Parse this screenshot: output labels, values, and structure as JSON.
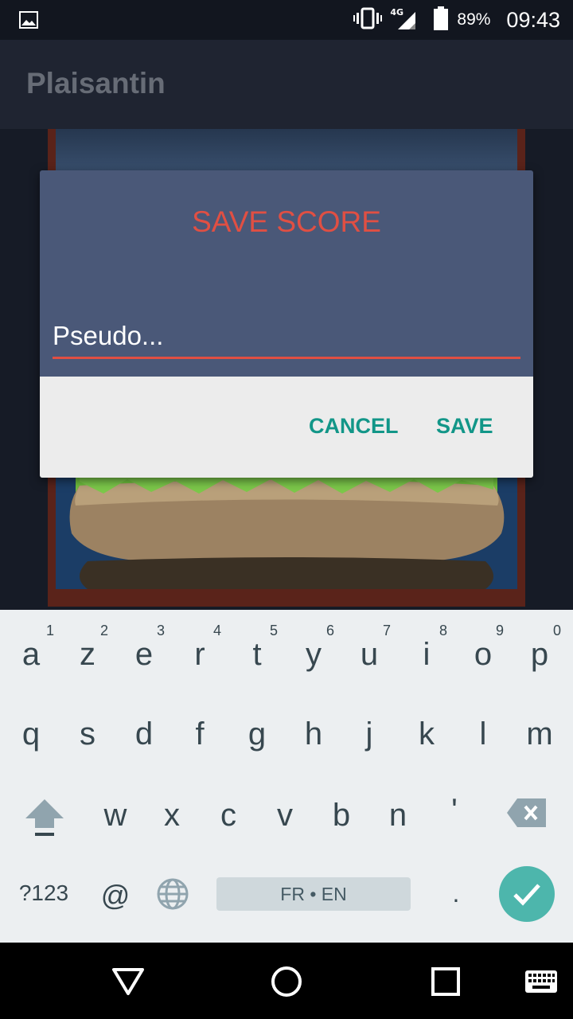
{
  "status_bar": {
    "network": "4G",
    "battery": "89%",
    "time": "09:43",
    "icons": [
      "image-icon",
      "vibrate-icon",
      "signal-icon",
      "battery-icon"
    ]
  },
  "app_bar": {
    "title": "Plaisantin"
  },
  "dialog": {
    "title": "SAVE SCORE",
    "input_placeholder": "Pseudo...",
    "input_value": "",
    "cancel_label": "CANCEL",
    "save_label": "SAVE",
    "accent": "#e04f43",
    "button_color": "#129688"
  },
  "keyboard": {
    "row1": [
      {
        "k": "a",
        "h": "1"
      },
      {
        "k": "z",
        "h": "2"
      },
      {
        "k": "e",
        "h": "3"
      },
      {
        "k": "r",
        "h": "4"
      },
      {
        "k": "t",
        "h": "5"
      },
      {
        "k": "y",
        "h": "6"
      },
      {
        "k": "u",
        "h": "7"
      },
      {
        "k": "i",
        "h": "8"
      },
      {
        "k": "o",
        "h": "9"
      },
      {
        "k": "p",
        "h": "0"
      }
    ],
    "row2": [
      "q",
      "s",
      "d",
      "f",
      "g",
      "h",
      "j",
      "k",
      "l",
      "m"
    ],
    "row3": [
      "w",
      "x",
      "c",
      "v",
      "b",
      "n",
      "'"
    ],
    "symbols_label": "?123",
    "at_label": "@",
    "space_label": "FR • EN",
    "period_label": ".",
    "icons": [
      "shift-icon",
      "backspace-icon",
      "globe-icon",
      "enter-check-icon"
    ]
  },
  "nav_bar": {
    "icons": [
      "back-icon",
      "home-icon",
      "recents-icon",
      "keyboard-switch-icon"
    ]
  }
}
